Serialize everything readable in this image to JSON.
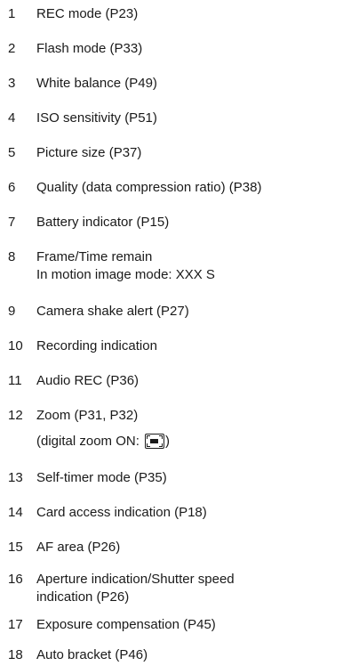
{
  "items": [
    {
      "num": "1",
      "text": "REC mode (P23)"
    },
    {
      "num": "2",
      "text": "Flash mode (P33)"
    },
    {
      "num": "3",
      "text": "White balance (P49)"
    },
    {
      "num": "4",
      "text": "ISO sensitivity (P51)"
    },
    {
      "num": "5",
      "text": "Picture size (P37)"
    },
    {
      "num": "6",
      "text": "Quality (data compression ratio) (P38)"
    },
    {
      "num": "7",
      "text": "Battery indicator (P15)"
    },
    {
      "num": "8",
      "line1": "Frame/Time remain",
      "line2": "In motion image mode: XXX S"
    },
    {
      "num": "9",
      "text": "Camera shake alert (P27)"
    },
    {
      "num": "10",
      "text": "Recording indication"
    },
    {
      "num": "11",
      "text": "Audio REC (P36)"
    },
    {
      "num": "12",
      "line1": "Zoom (P31, P32)",
      "line2_prefix": "(digital zoom ON: ",
      "line2_suffix": ")",
      "icon": "digital-zoom-icon"
    },
    {
      "num": "13",
      "text": "Self-timer mode (P35)"
    },
    {
      "num": "14",
      "text": "Card access indication (P18)"
    },
    {
      "num": "15",
      "text": "AF area (P26)"
    },
    {
      "num": "16",
      "line1": "Aperture indication/Shutter speed",
      "line2": "indication (P26)"
    },
    {
      "num": "17",
      "text": "Exposure compensation (P45)"
    },
    {
      "num": "18",
      "text": "Auto bracket (P46)"
    }
  ]
}
